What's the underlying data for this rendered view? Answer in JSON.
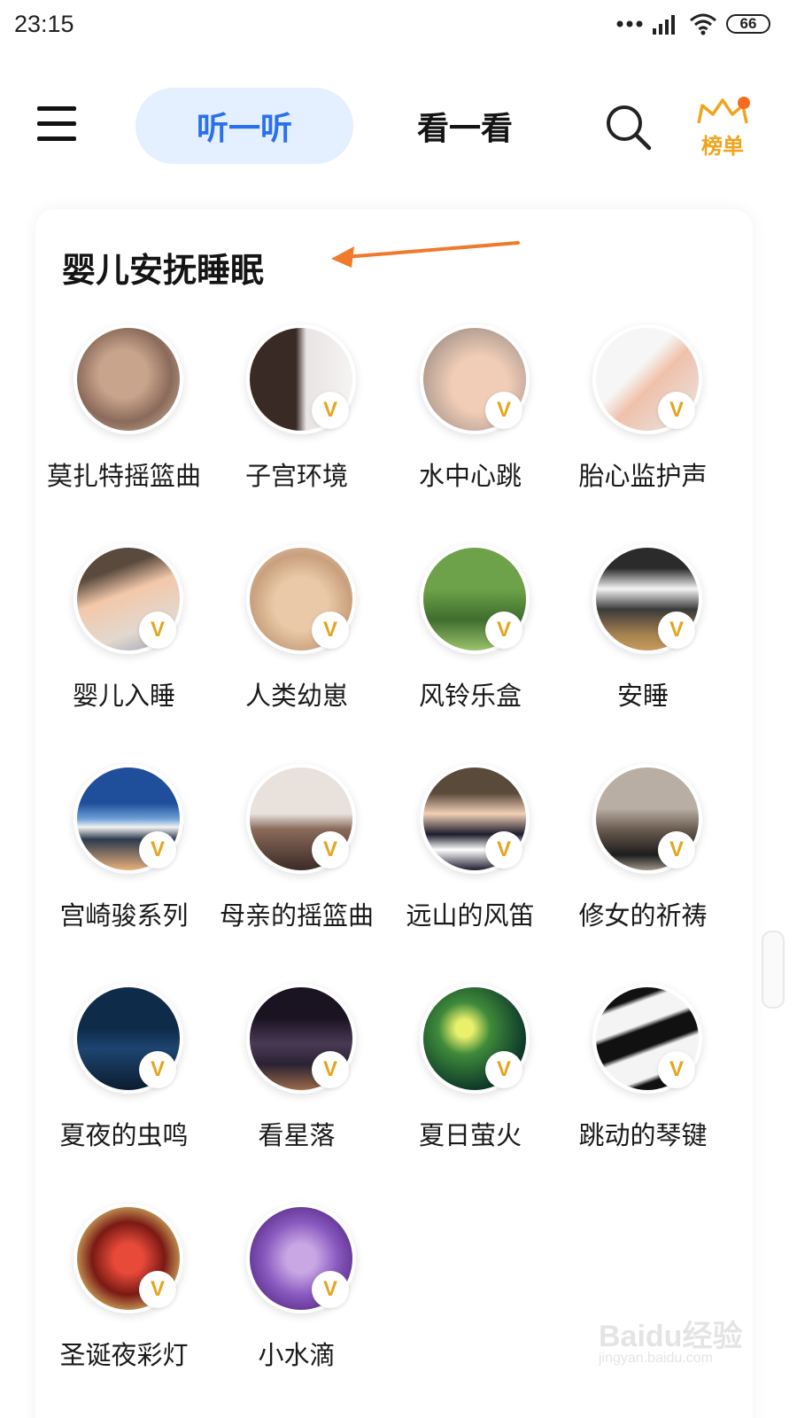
{
  "status_bar": {
    "time": "23:15",
    "battery": "66"
  },
  "header": {
    "tabs": [
      {
        "label": "听一听",
        "active": true
      },
      {
        "label": "看一看",
        "active": false
      }
    ],
    "rank_label": "榜单",
    "accent_color": "#2a6ff0",
    "active_tab_bg": "#e4efff",
    "rank_color": "#f0a41c"
  },
  "section": {
    "title": "婴儿安抚睡眠",
    "items": [
      {
        "label": "莫扎特摇篮曲",
        "vip": false,
        "icon": "sleeping-twins-photo"
      },
      {
        "label": "子宫环境",
        "vip": true,
        "icon": "pregnant-belly-photo"
      },
      {
        "label": "水中心跳",
        "vip": true,
        "icon": "sleeping-newborn-photo"
      },
      {
        "label": "胎心监护声",
        "vip": true,
        "icon": "baby-hands-photo"
      },
      {
        "label": "婴儿入睡",
        "vip": true,
        "icon": "sleeping-baby-photo"
      },
      {
        "label": "人类幼崽",
        "vip": true,
        "icon": "newborn-hat-photo"
      },
      {
        "label": "风铃乐盒",
        "vip": true,
        "icon": "wind-chime-photo"
      },
      {
        "label": "安睡",
        "vip": true,
        "icon": "puppies-photo"
      },
      {
        "label": "宫崎骏系列",
        "vip": true,
        "icon": "mount-fuji-photo"
      },
      {
        "label": "母亲的摇篮曲",
        "vip": true,
        "icon": "cradle-photo"
      },
      {
        "label": "远山的风笛",
        "vip": true,
        "icon": "bagpipe-boy-photo"
      },
      {
        "label": "修女的祈祷",
        "vip": true,
        "icon": "nuns-church-photo"
      },
      {
        "label": "夏夜的虫鸣",
        "vip": true,
        "icon": "night-house-photo"
      },
      {
        "label": "看星落",
        "vip": true,
        "icon": "starry-sky-photo"
      },
      {
        "label": "夏日萤火",
        "vip": true,
        "icon": "fireflies-photo"
      },
      {
        "label": "跳动的琴键",
        "vip": true,
        "icon": "piano-keys-photo"
      },
      {
        "label": "圣诞夜彩灯",
        "vip": true,
        "icon": "christmas-lights-photo"
      },
      {
        "label": "小水滴",
        "vip": true,
        "icon": "water-drops-photo"
      }
    ],
    "vip_mark": "V"
  },
  "watermark": {
    "main": "Baidu经验",
    "sub": "jingyan.baidu.com"
  }
}
